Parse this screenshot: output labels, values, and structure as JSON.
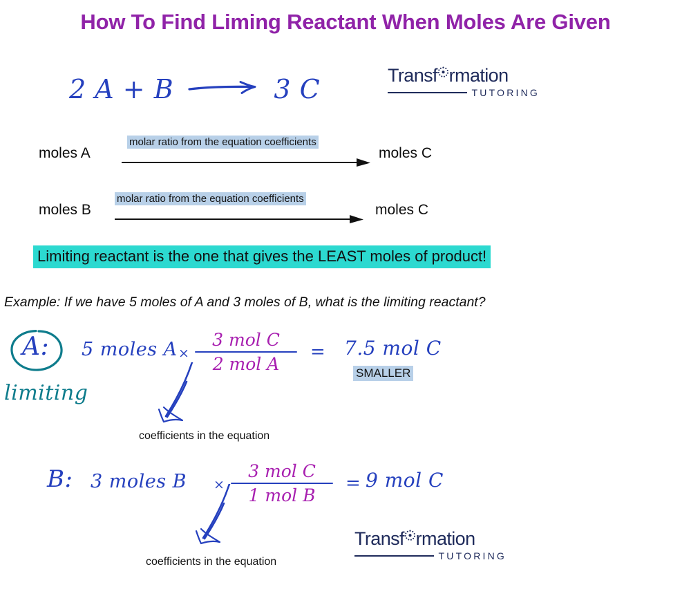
{
  "slide": {
    "title": "How To Find Liming Reactant When Moles Are Given",
    "title_color": "#9023A8",
    "background_color": "#ffffff"
  },
  "equation": {
    "left_side": "2 A + B",
    "arrow": "⟶",
    "right_side": "3 C",
    "ink_color": "#2540BE"
  },
  "logo": {
    "word_before_o": "Transf",
    "word_after_o": "rmation",
    "subtitle": "TUTORING",
    "color": "#1F2B5B"
  },
  "conversions": {
    "note": "molar ratio from the equation coefficients",
    "note_highlight_color": "#B8D0E8",
    "rows": [
      {
        "from": "moles A",
        "to": "moles C"
      },
      {
        "from": "moles B",
        "to": "moles C"
      }
    ]
  },
  "statement": {
    "text": "Limiting reactant is the one that gives the LEAST moles of product!",
    "highlight_color": "#2CD9D0"
  },
  "example": {
    "prompt": "Example: If we have 5 moles of A and 3 moles of B, what is the limiting reactant?"
  },
  "work_a": {
    "label": "A:",
    "limiting_note": "limiting",
    "circle_color": "#0E7C8C",
    "quantity": "5 moles A",
    "times": "×",
    "numerator": "3 mol C",
    "denominator": "2 mol A",
    "equals": "=",
    "result": "7.5 mol C",
    "smaller_badge": "SMALLER",
    "annotation": "coefficients in the equation"
  },
  "work_b": {
    "label": "B:",
    "quantity": "3 moles B",
    "times": "×",
    "numerator": "3 mol C",
    "denominator": "1 mol B",
    "equals": "=",
    "result": "9 mol C",
    "annotation": "coefficients in the equation"
  }
}
